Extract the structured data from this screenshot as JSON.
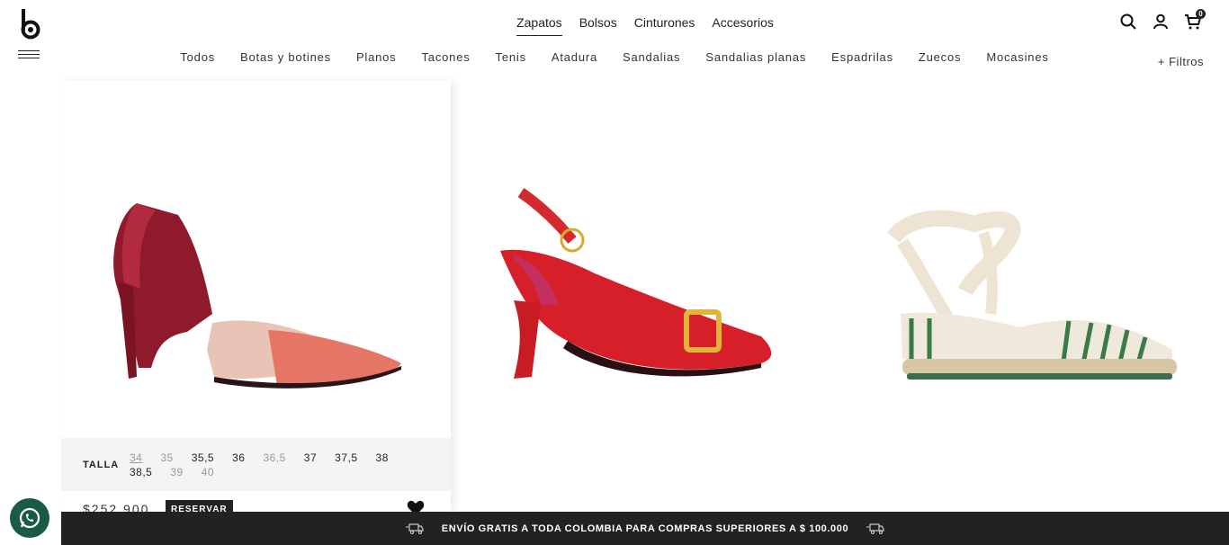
{
  "brand": {
    "logo_letter": "b"
  },
  "top_nav": [
    {
      "label": "Zapatos",
      "active": true
    },
    {
      "label": "Bolsos",
      "active": false
    },
    {
      "label": "Cinturones",
      "active": false
    },
    {
      "label": "Accesorios",
      "active": false
    }
  ],
  "categories": [
    "Todos",
    "Botas y botines",
    "Planos",
    "Tacones",
    "Tenis",
    "Atadura",
    "Sandalias",
    "Sandalias planas",
    "Espadrilas",
    "Zuecos",
    "Mocasines"
  ],
  "filters_label": "+ Filtros",
  "header_icons": {
    "search": "search-icon",
    "account": "user-icon",
    "cart": "cart-icon",
    "cart_count": "0"
  },
  "product1": {
    "size_label": "TALLA",
    "sizes": [
      {
        "v": "34",
        "available": false,
        "selected": true
      },
      {
        "v": "35",
        "available": false
      },
      {
        "v": "35,5",
        "available": true
      },
      {
        "v": "36",
        "available": true
      },
      {
        "v": "36,5",
        "available": false
      },
      {
        "v": "37",
        "available": true
      },
      {
        "v": "37,5",
        "available": true
      },
      {
        "v": "38",
        "available": true
      },
      {
        "v": "38,5",
        "available": true
      },
      {
        "v": "39",
        "available": false
      },
      {
        "v": "40",
        "available": false
      }
    ],
    "price": "$252.900",
    "reserve_label": "RESERVAR"
  },
  "banner_text": "ENVÍO GRATIS A TODA COLOMBIA PARA COMPRAS SUPERIORES A $ 100.000",
  "colors": {
    "dark": "#222222",
    "whatsapp": "#1a5b47",
    "panel": "#f4f4f4"
  }
}
